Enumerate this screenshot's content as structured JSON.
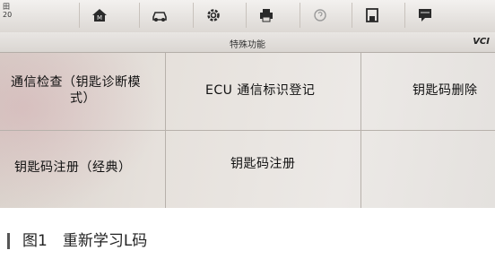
{
  "status": {
    "corner_line1": "田",
    "corner_line2": "20"
  },
  "toolbar": {
    "buttons": [
      {
        "icon": "home-icon"
      },
      {
        "icon": "car-icon"
      },
      {
        "icon": "gear-icon"
      },
      {
        "icon": "printer-icon"
      },
      {
        "icon": "help-icon"
      },
      {
        "icon": "save-icon"
      },
      {
        "icon": "message-icon"
      }
    ]
  },
  "header": {
    "title": "特殊功能",
    "vci": "VCI"
  },
  "menu": {
    "items": [
      {
        "label_line1": "通信检查（钥匙诊断模",
        "label_line2": "式）"
      },
      {
        "label": "ECU 通信标识登记"
      },
      {
        "label": "钥匙码删除"
      },
      {
        "label": "钥匙码注册（经典）"
      },
      {
        "label": "钥匙码注册"
      }
    ]
  },
  "caption": {
    "text": "图1　重新学习L码"
  }
}
